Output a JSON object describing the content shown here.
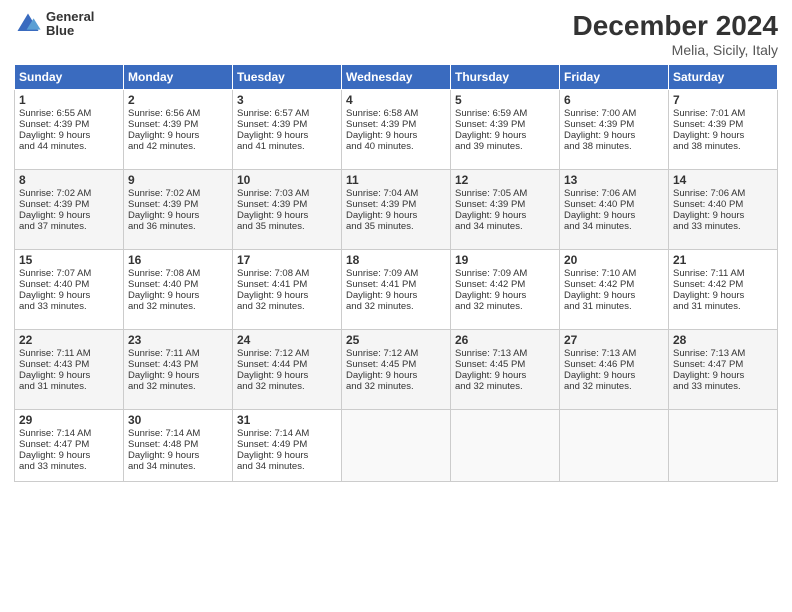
{
  "header": {
    "logo_line1": "General",
    "logo_line2": "Blue",
    "title": "December 2024",
    "subtitle": "Melia, Sicily, Italy"
  },
  "columns": [
    "Sunday",
    "Monday",
    "Tuesday",
    "Wednesday",
    "Thursday",
    "Friday",
    "Saturday"
  ],
  "weeks": [
    [
      {
        "day": "1",
        "lines": [
          "Sunrise: 6:55 AM",
          "Sunset: 4:39 PM",
          "Daylight: 9 hours",
          "and 44 minutes."
        ]
      },
      {
        "day": "2",
        "lines": [
          "Sunrise: 6:56 AM",
          "Sunset: 4:39 PM",
          "Daylight: 9 hours",
          "and 42 minutes."
        ]
      },
      {
        "day": "3",
        "lines": [
          "Sunrise: 6:57 AM",
          "Sunset: 4:39 PM",
          "Daylight: 9 hours",
          "and 41 minutes."
        ]
      },
      {
        "day": "4",
        "lines": [
          "Sunrise: 6:58 AM",
          "Sunset: 4:39 PM",
          "Daylight: 9 hours",
          "and 40 minutes."
        ]
      },
      {
        "day": "5",
        "lines": [
          "Sunrise: 6:59 AM",
          "Sunset: 4:39 PM",
          "Daylight: 9 hours",
          "and 39 minutes."
        ]
      },
      {
        "day": "6",
        "lines": [
          "Sunrise: 7:00 AM",
          "Sunset: 4:39 PM",
          "Daylight: 9 hours",
          "and 38 minutes."
        ]
      },
      {
        "day": "7",
        "lines": [
          "Sunrise: 7:01 AM",
          "Sunset: 4:39 PM",
          "Daylight: 9 hours",
          "and 38 minutes."
        ]
      }
    ],
    [
      {
        "day": "8",
        "lines": [
          "Sunrise: 7:02 AM",
          "Sunset: 4:39 PM",
          "Daylight: 9 hours",
          "and 37 minutes."
        ]
      },
      {
        "day": "9",
        "lines": [
          "Sunrise: 7:02 AM",
          "Sunset: 4:39 PM",
          "Daylight: 9 hours",
          "and 36 minutes."
        ]
      },
      {
        "day": "10",
        "lines": [
          "Sunrise: 7:03 AM",
          "Sunset: 4:39 PM",
          "Daylight: 9 hours",
          "and 35 minutes."
        ]
      },
      {
        "day": "11",
        "lines": [
          "Sunrise: 7:04 AM",
          "Sunset: 4:39 PM",
          "Daylight: 9 hours",
          "and 35 minutes."
        ]
      },
      {
        "day": "12",
        "lines": [
          "Sunrise: 7:05 AM",
          "Sunset: 4:39 PM",
          "Daylight: 9 hours",
          "and 34 minutes."
        ]
      },
      {
        "day": "13",
        "lines": [
          "Sunrise: 7:06 AM",
          "Sunset: 4:40 PM",
          "Daylight: 9 hours",
          "and 34 minutes."
        ]
      },
      {
        "day": "14",
        "lines": [
          "Sunrise: 7:06 AM",
          "Sunset: 4:40 PM",
          "Daylight: 9 hours",
          "and 33 minutes."
        ]
      }
    ],
    [
      {
        "day": "15",
        "lines": [
          "Sunrise: 7:07 AM",
          "Sunset: 4:40 PM",
          "Daylight: 9 hours",
          "and 33 minutes."
        ]
      },
      {
        "day": "16",
        "lines": [
          "Sunrise: 7:08 AM",
          "Sunset: 4:40 PM",
          "Daylight: 9 hours",
          "and 32 minutes."
        ]
      },
      {
        "day": "17",
        "lines": [
          "Sunrise: 7:08 AM",
          "Sunset: 4:41 PM",
          "Daylight: 9 hours",
          "and 32 minutes."
        ]
      },
      {
        "day": "18",
        "lines": [
          "Sunrise: 7:09 AM",
          "Sunset: 4:41 PM",
          "Daylight: 9 hours",
          "and 32 minutes."
        ]
      },
      {
        "day": "19",
        "lines": [
          "Sunrise: 7:09 AM",
          "Sunset: 4:42 PM",
          "Daylight: 9 hours",
          "and 32 minutes."
        ]
      },
      {
        "day": "20",
        "lines": [
          "Sunrise: 7:10 AM",
          "Sunset: 4:42 PM",
          "Daylight: 9 hours",
          "and 31 minutes."
        ]
      },
      {
        "day": "21",
        "lines": [
          "Sunrise: 7:11 AM",
          "Sunset: 4:42 PM",
          "Daylight: 9 hours",
          "and 31 minutes."
        ]
      }
    ],
    [
      {
        "day": "22",
        "lines": [
          "Sunrise: 7:11 AM",
          "Sunset: 4:43 PM",
          "Daylight: 9 hours",
          "and 31 minutes."
        ]
      },
      {
        "day": "23",
        "lines": [
          "Sunrise: 7:11 AM",
          "Sunset: 4:43 PM",
          "Daylight: 9 hours",
          "and 32 minutes."
        ]
      },
      {
        "day": "24",
        "lines": [
          "Sunrise: 7:12 AM",
          "Sunset: 4:44 PM",
          "Daylight: 9 hours",
          "and 32 minutes."
        ]
      },
      {
        "day": "25",
        "lines": [
          "Sunrise: 7:12 AM",
          "Sunset: 4:45 PM",
          "Daylight: 9 hours",
          "and 32 minutes."
        ]
      },
      {
        "day": "26",
        "lines": [
          "Sunrise: 7:13 AM",
          "Sunset: 4:45 PM",
          "Daylight: 9 hours",
          "and 32 minutes."
        ]
      },
      {
        "day": "27",
        "lines": [
          "Sunrise: 7:13 AM",
          "Sunset: 4:46 PM",
          "Daylight: 9 hours",
          "and 32 minutes."
        ]
      },
      {
        "day": "28",
        "lines": [
          "Sunrise: 7:13 AM",
          "Sunset: 4:47 PM",
          "Daylight: 9 hours",
          "and 33 minutes."
        ]
      }
    ],
    [
      {
        "day": "29",
        "lines": [
          "Sunrise: 7:14 AM",
          "Sunset: 4:47 PM",
          "Daylight: 9 hours",
          "and 33 minutes."
        ]
      },
      {
        "day": "30",
        "lines": [
          "Sunrise: 7:14 AM",
          "Sunset: 4:48 PM",
          "Daylight: 9 hours",
          "and 34 minutes."
        ]
      },
      {
        "day": "31",
        "lines": [
          "Sunrise: 7:14 AM",
          "Sunset: 4:49 PM",
          "Daylight: 9 hours",
          "and 34 minutes."
        ]
      },
      null,
      null,
      null,
      null
    ]
  ]
}
